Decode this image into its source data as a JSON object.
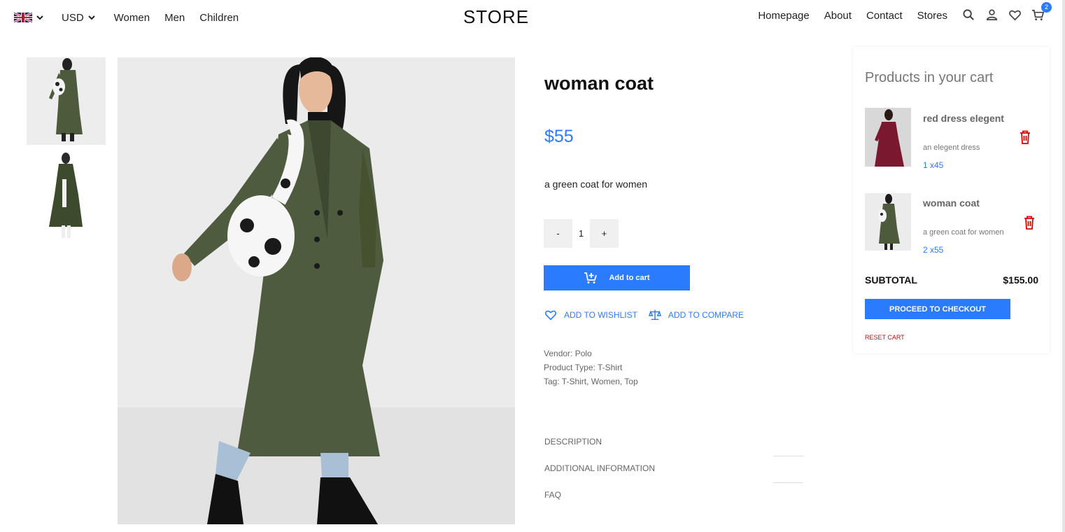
{
  "header": {
    "currency": "USD",
    "nav_left": [
      "Women",
      "Men",
      "Children"
    ],
    "logo": "STORE",
    "nav_right": [
      "Homepage",
      "About",
      "Contact",
      "Stores"
    ],
    "cart_count": "2"
  },
  "product": {
    "title": "woman coat",
    "price": "$55",
    "description": "a green coat for women",
    "qty_minus": "-",
    "qty_value": "1",
    "qty_plus": "+",
    "add_to_cart": "Add to cart",
    "wishlist": "ADD TO WISHLIST",
    "compare": "ADD TO COMPARE",
    "vendor": "Vendor: Polo",
    "product_type": "Product Type: T-Shirt",
    "tags": "Tag: T-Shirt, Women, Top",
    "tabs": [
      "DESCRIPTION",
      "ADDITIONAL INFORMATION",
      "FAQ"
    ]
  },
  "cart": {
    "title": "Products in your cart",
    "items": [
      {
        "name": "red dress elegent",
        "desc": "an elegent dress",
        "qty": "1 x45"
      },
      {
        "name": "woman coat",
        "desc": "a green coat for women",
        "qty": "2 x55"
      }
    ],
    "subtotal_label": "SUBTOTAL",
    "subtotal_value": "$155.00",
    "checkout": "PROCEED TO CHECKOUT",
    "reset": "RESET CART"
  },
  "colors": {
    "accent": "#2b7bff",
    "danger": "#dd0000"
  }
}
